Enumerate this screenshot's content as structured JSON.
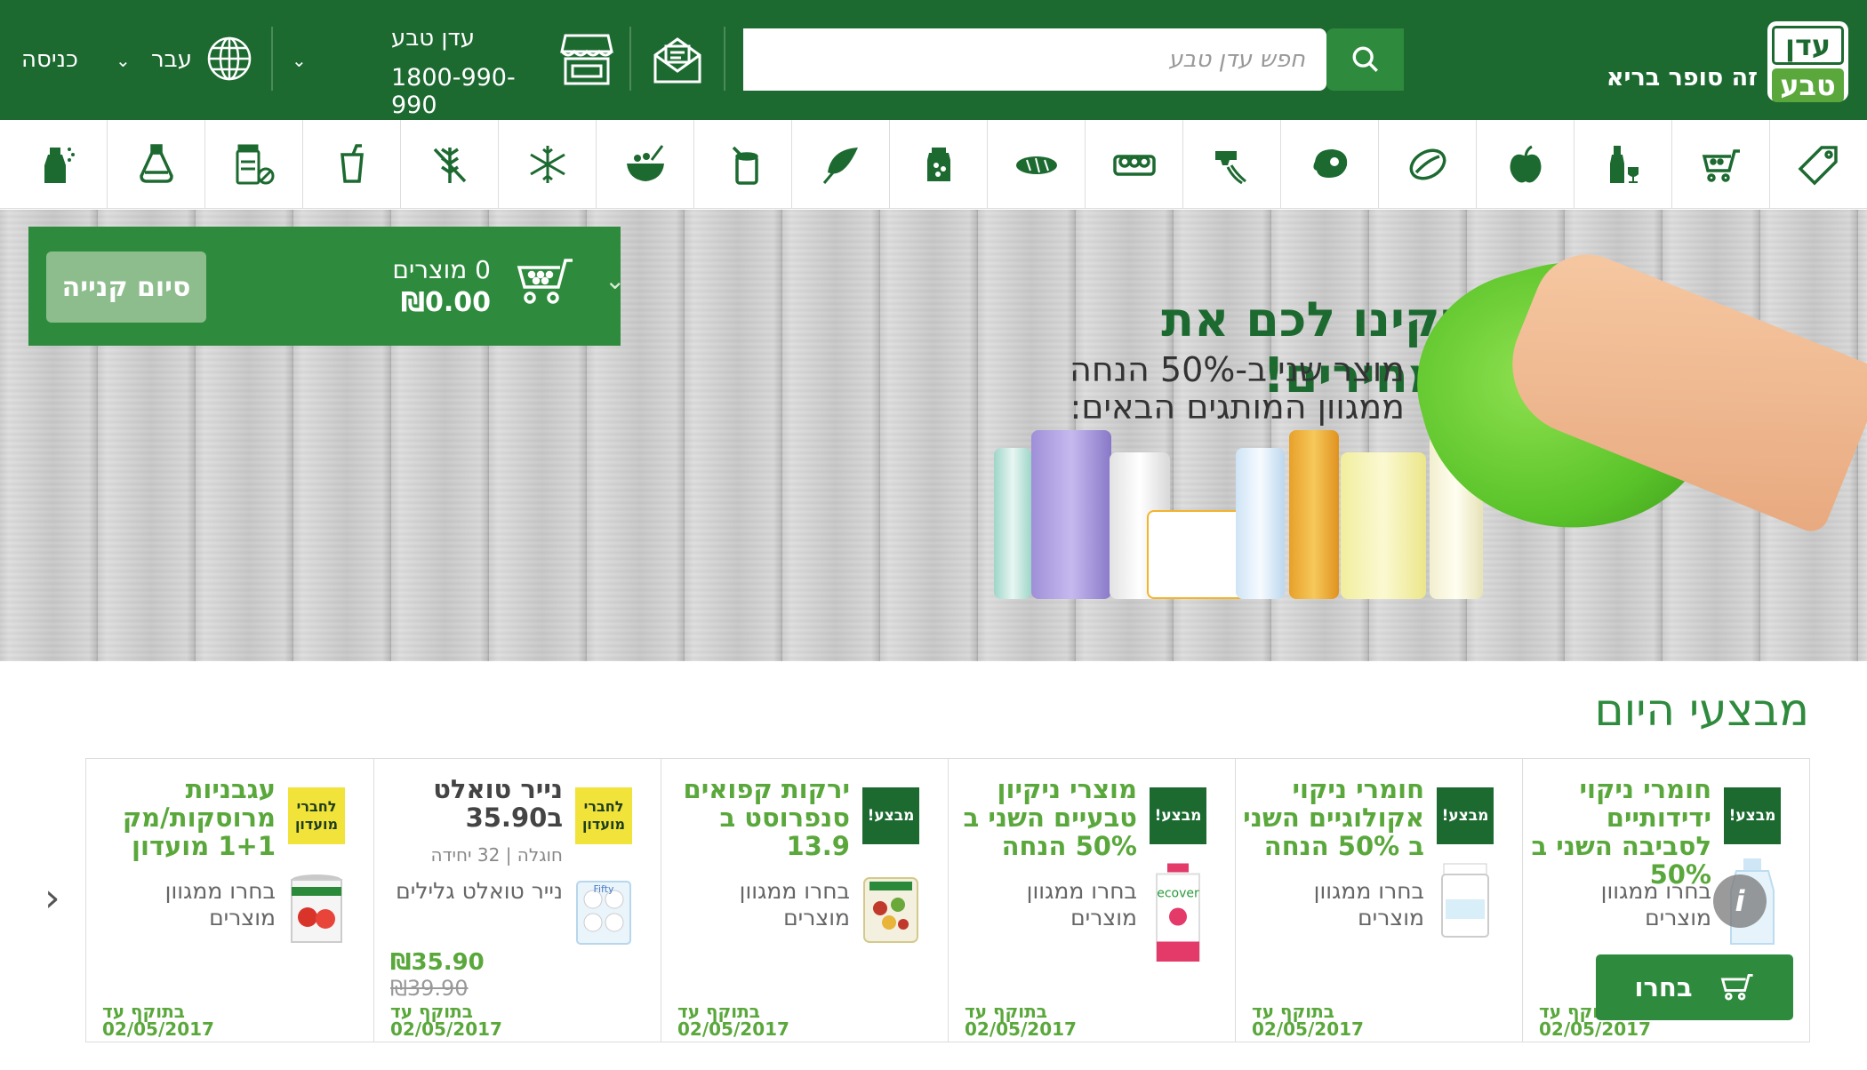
{
  "header": {
    "logo_top": "עדן",
    "logo_bottom": "טבע",
    "tagline": "זה סופר בריא",
    "search_placeholder": "חפש עדן טבע",
    "store_name": "עדן טבע",
    "store_phone": "1800-990-990",
    "language": "עבר",
    "login": "כניסה"
  },
  "categories": [
    "tag-icon",
    "basket-icon",
    "wine-icon",
    "apple-icon",
    "nut-icon",
    "steak-icon",
    "mixer-icon",
    "eggs-icon",
    "bread-icon",
    "jam-icon",
    "leaf-icon",
    "can-icon",
    "bowl-icon",
    "snowflake-icon",
    "wheat-off-icon",
    "cup-icon",
    "pills-icon",
    "flask-icon",
    "spray-icon"
  ],
  "banner": {
    "title": "ניקינו לכם את המחירים!",
    "sub1": "מוצר שני ב-50% הנחה",
    "sub2": "ממגוון המותגים הבאים:"
  },
  "cart": {
    "count": "0 מוצרים",
    "total": "₪0.00",
    "checkout": "סיום קנייה"
  },
  "deals": {
    "title": "מבצעי היום",
    "choose_label": "בחרו",
    "items": [
      {
        "badge": "מבצע!",
        "title": "חומרי ניקוי ידידותיים לסביבה השני ב 50%",
        "desc": "בחרו ממגוון מוצרים",
        "valid": "בתוקף עד\n02/05/2017"
      },
      {
        "badge": "מבצע!",
        "title": "חומרי ניקוי אקולוגיים השני ב 50% הנחה",
        "desc": "בחרו ממגוון מוצרים",
        "valid": "בתוקף עד\n02/05/2017"
      },
      {
        "badge": "מבצע!",
        "title": "מוצרי ניקיון טבעיים השני ב 50% הנחה",
        "desc": "בחרו ממגוון מוצרים",
        "valid": "בתוקף עד\n02/05/2017"
      },
      {
        "badge": "מבצע!",
        "title": "ירקות קפואים סנפרוסט ב 13.9",
        "desc": "בחרו ממגוון מוצרים",
        "valid": "בתוקף עד\n02/05/2017"
      },
      {
        "badge": "לחברי מועדון",
        "title": "נייר טואלט ב35.90",
        "meta": "חוגלה | 32 יחידה",
        "desc": "נייר טואלט גלילים",
        "price": "₪35.90",
        "old_price": "₪39.90",
        "valid": "בתוקף עד\n02/05/2017"
      },
      {
        "badge": "לחברי מועדון",
        "title": "עגבניות מרוסקות/מק 1+1 מועדון",
        "desc": "בחרו ממגוון מוצרים",
        "valid": "בתוקף עד\n02/05/2017"
      }
    ]
  },
  "colors": {
    "header_bg": "#1d6a31",
    "accent": "#2e8b3d",
    "light_green": "#5aa83c",
    "club_badge": "#f2e33a"
  }
}
